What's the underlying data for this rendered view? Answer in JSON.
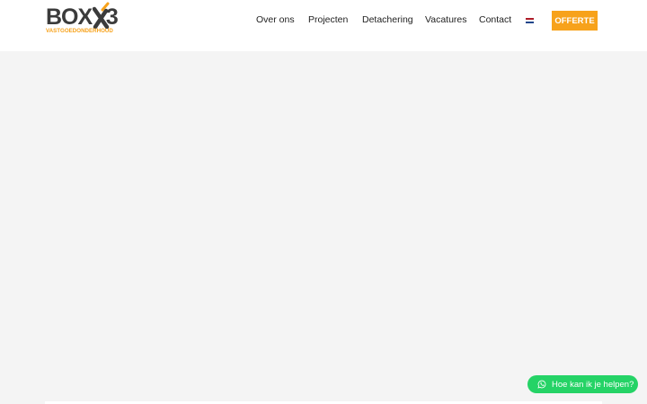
{
  "brand": {
    "name": "BOX",
    "number": "3",
    "tagline": "VASTGOEDONDERHOUD",
    "dark_color": "#3b3b3b",
    "accent_color": "#f7a21b"
  },
  "nav": {
    "items": [
      {
        "label": "Over ons"
      },
      {
        "label": "Projecten"
      },
      {
        "label": "Detachering"
      },
      {
        "label": "Vacatures"
      },
      {
        "label": "Contact"
      }
    ],
    "language_flag": "netherlands-flag-icon"
  },
  "cta": {
    "label": "OFFERTE",
    "color": "#f7a21b"
  },
  "chat": {
    "label": "Hoe kan ik je helpen?",
    "icon": "whatsapp-icon",
    "color": "#25d366"
  }
}
